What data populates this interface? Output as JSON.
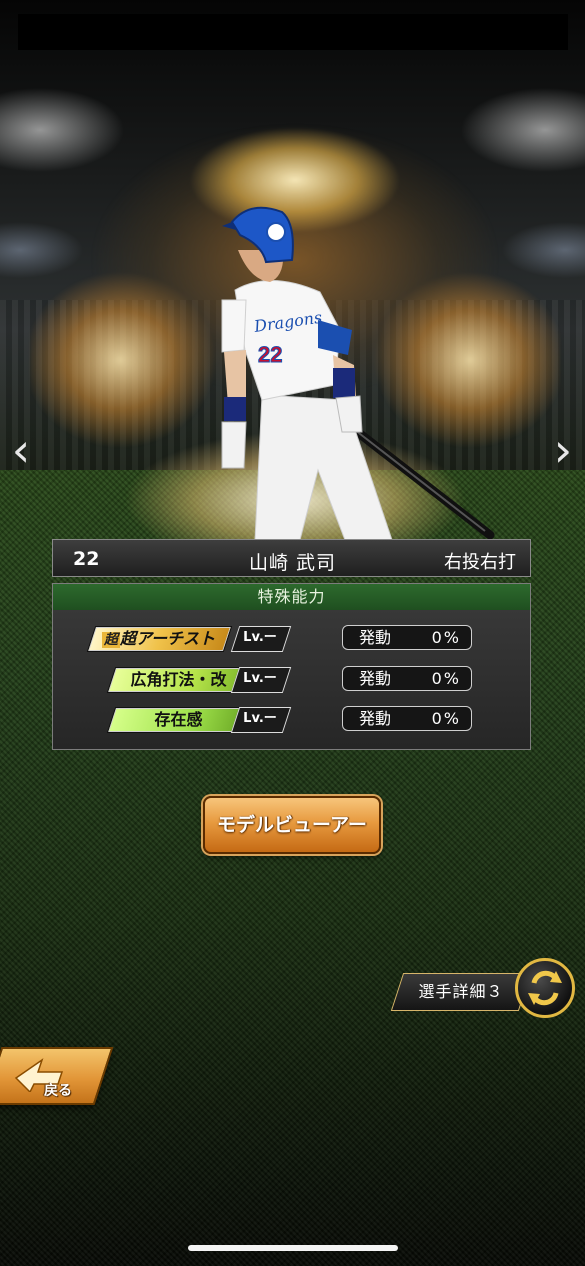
{
  "player": {
    "number": "22",
    "name": "山崎 武司",
    "handedness": "右投右打",
    "uniform_text": "Dragons",
    "uniform_number": "22"
  },
  "abilities": {
    "header": "特殊能力",
    "items": [
      {
        "name": "超アーチスト",
        "prefix": "超",
        "level": "Lv.ー",
        "rate_label": "発動",
        "rate_value": "0%",
        "badge_color": "#f0c24a"
      },
      {
        "name": "広角打法・改",
        "level": "Lv.ー",
        "rate_label": "発動",
        "rate_value": "0%",
        "badge_color": "#b6e44a"
      },
      {
        "name": "存在感",
        "level": "Lv.ー",
        "rate_label": "発動",
        "rate_value": "0%",
        "badge_color": "#9ee04a"
      }
    ]
  },
  "buttons": {
    "model_viewer": "モデルビューアー",
    "player_detail": "選手詳細３",
    "back": "戻る"
  },
  "nav": {
    "prev_icon": "chevron-left-icon",
    "next_icon": "chevron-right-icon"
  },
  "colors": {
    "ability_header": "#2d6a2d",
    "button_orange": "#e79a3f",
    "gold_border": "#e2b842"
  }
}
